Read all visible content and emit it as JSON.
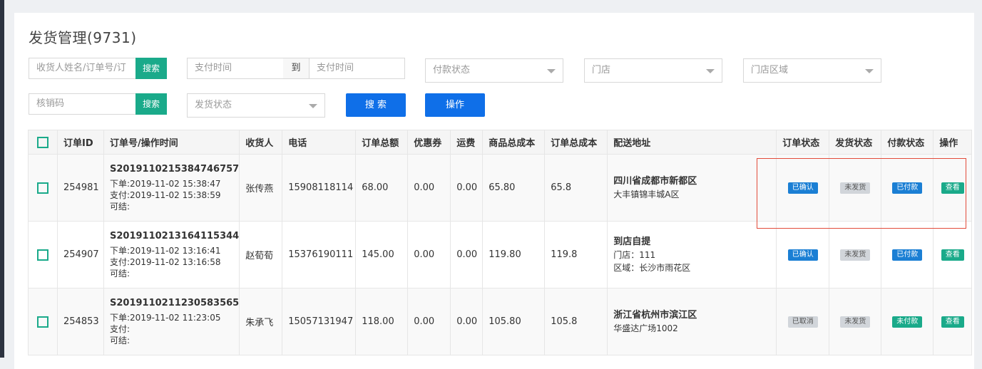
{
  "page": {
    "title": "发货管理(9731)"
  },
  "filters": {
    "search_placeholder": "收货人姓名/订单号/订",
    "search_btn": "搜索",
    "pay_time_start": "支付时间",
    "to_label": "到",
    "pay_time_end": "支付时间",
    "pay_status": "付款状态",
    "store": "门店",
    "store_area": "门店区域",
    "verify_code": "核销码",
    "verify_btn": "搜索",
    "ship_status": "发货状态",
    "search_main": "搜 索",
    "operate": "操作"
  },
  "table": {
    "headers": [
      "订单ID",
      "订单号/操作时间",
      "收货人",
      "电话",
      "订单总额",
      "优惠券",
      "运费",
      "商品总成本",
      "订单总成本",
      "配送地址",
      "订单状态",
      "发货状态",
      "付款状态",
      "操作"
    ],
    "rows": [
      {
        "id": "254981",
        "order_no": "S2019110215384746757",
        "order_time": "下单:2019-11-02 15:38:47",
        "pay_time": "支付:2019-11-02 15:38:59",
        "settle": "可结:",
        "receiver": "张传燕",
        "phone": "15908118114",
        "total": "68.00",
        "coupon": "0.00",
        "freight": "0.00",
        "goods_cost": "65.80",
        "order_cost": "65.8",
        "addr1": "四川省成都市新都区",
        "addr2": "大丰镇锦丰城A区",
        "addr3": "",
        "order_status": "已确认",
        "ship_status": "未发货",
        "pay_status": "已付款",
        "action": "查看"
      },
      {
        "id": "254907",
        "order_no": "S2019110213164115344",
        "order_time": "下单:2019-11-02 13:16:41",
        "pay_time": "支付:2019-11-02 13:16:58",
        "settle": "可结:",
        "receiver": "赵荀荀",
        "phone": "15376190111",
        "total": "145.00",
        "coupon": "0.00",
        "freight": "0.00",
        "goods_cost": "119.80",
        "order_cost": "119.8",
        "addr1": "到店自提",
        "addr2": "门店：111",
        "addr3": "区域：长沙市雨花区",
        "order_status": "已确认",
        "ship_status": "未发货",
        "pay_status": "已付款",
        "action": "查看"
      },
      {
        "id": "254853",
        "order_no": "S2019110211230583565",
        "order_time": "下单:2019-11-02 11:23:05",
        "pay_time": "支付:",
        "settle": "可结:",
        "receiver": "朱承飞",
        "phone": "15057131947",
        "total": "118.00",
        "coupon": "0.00",
        "freight": "0.00",
        "goods_cost": "105.80",
        "order_cost": "105.8",
        "addr1": "浙江省杭州市滨江区",
        "addr2": "华盛达广场1002",
        "addr3": "",
        "order_status": "已取消",
        "ship_status": "未发货",
        "pay_status": "未付款",
        "action": "查看"
      }
    ]
  },
  "colors": {
    "accent_green": "#1aaa8a",
    "accent_blue": "#0f6fe8",
    "highlight": "#e24b3a"
  }
}
